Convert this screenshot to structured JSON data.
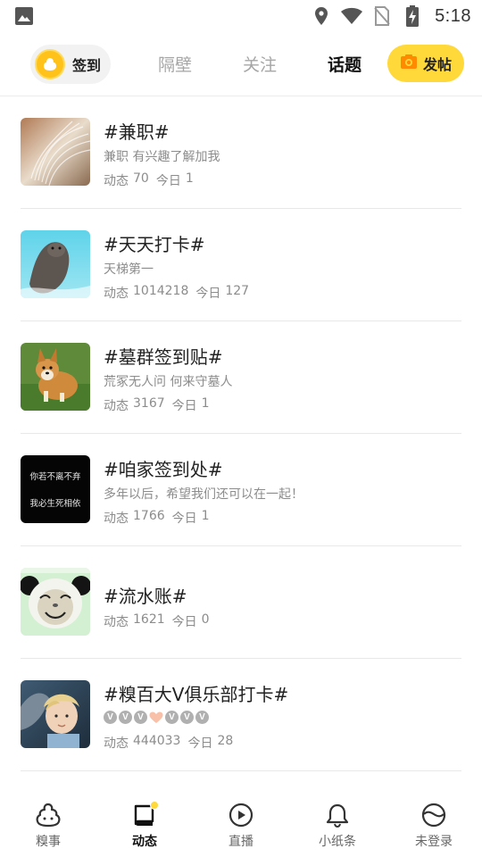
{
  "status_bar": {
    "time": "5:18",
    "icons": [
      "image-icon",
      "location-icon",
      "wifi-icon",
      "no-sim-icon",
      "battery-charging-icon"
    ]
  },
  "top_nav": {
    "checkin_label": "签到",
    "tabs": [
      {
        "label": "隔壁",
        "active": false
      },
      {
        "label": "关注",
        "active": false
      },
      {
        "label": "话题",
        "active": true
      }
    ],
    "post_label": "发帖",
    "accent_color": "#ffd83a"
  },
  "topics": [
    {
      "title": "#兼职#",
      "description": "兼职 有兴趣了解加我",
      "stats_label": "动态",
      "posts": "70",
      "today_label": "今日",
      "today": "1",
      "thumb": "book-pages"
    },
    {
      "title": "#天天打卡#",
      "description": "天梯第一",
      "stats_label": "动态",
      "posts": "1014218",
      "today_label": "今日",
      "today": "127",
      "thumb": "otter"
    },
    {
      "title": "#墓群签到贴#",
      "description": "荒冢无人问 何来守墓人",
      "stats_label": "动态",
      "posts": "3167",
      "today_label": "今日",
      "today": "1",
      "thumb": "corgi"
    },
    {
      "title": "#咱家签到处#",
      "description": "多年以后，希望我们还可以在一起！",
      "stats_label": "动态",
      "posts": "1766",
      "today_label": "今日",
      "today": "1",
      "thumb": "text-black",
      "thumb_text_1": "你若不离不弃",
      "thumb_text_2": "我必生死相依"
    },
    {
      "title": "#流水账#",
      "description": "",
      "stats_label": "动态",
      "posts": "1621",
      "today_label": "今日",
      "today": "0",
      "thumb": "panda-meme"
    },
    {
      "title": "#糗百大V俱乐部打卡#",
      "badges": [
        "V",
        "V",
        "V",
        "heart",
        "V",
        "V",
        "V"
      ],
      "stats_label": "动态",
      "posts": "444033",
      "today_label": "今日",
      "today": "28",
      "thumb": "child-photo"
    }
  ],
  "bottom_nav": [
    {
      "label": "糗事",
      "icon": "poop-icon",
      "active": false
    },
    {
      "label": "动态",
      "icon": "feed-icon",
      "active": true,
      "badge_dot": true
    },
    {
      "label": "直播",
      "icon": "play-icon",
      "active": false
    },
    {
      "label": "小纸条",
      "icon": "bell-icon",
      "active": false
    },
    {
      "label": "未登录",
      "icon": "profile-icon",
      "active": false
    }
  ]
}
